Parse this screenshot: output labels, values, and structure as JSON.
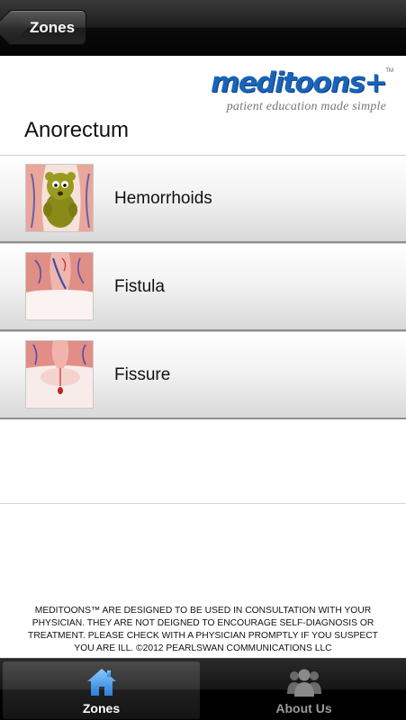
{
  "navbar": {
    "back_label": "Zones"
  },
  "logo": {
    "wordmark": "meditoons",
    "plus": "+",
    "trademark": "TM",
    "tagline": "patient education made simple"
  },
  "section": {
    "title": "Anorectum"
  },
  "items": [
    {
      "label": "Hemorrhoids",
      "icon": "hemorrhoid-character-icon"
    },
    {
      "label": "Fistula",
      "icon": "fistula-illustration-icon"
    },
    {
      "label": "Fissure",
      "icon": "fissure-illustration-icon"
    }
  ],
  "disclaimer": "MEDITOONS™ ARE DESIGNED TO BE USED IN CONSULTATION WITH YOUR PHYSICIAN. THEY ARE NOT DEIGNED TO ENCOURAGE SELF-DIAGNOSIS OR TREATMENT. PLEASE CHECK WITH A PHYSICIAN PROMPTLY IF YOU SUSPECT YOU ARE ILL. ©2012 PEARLSWAN COMMUNICATIONS LLC",
  "tabbar": {
    "tabs": [
      {
        "label": "Zones",
        "icon": "house-icon",
        "active": true
      },
      {
        "label": "About Us",
        "icon": "people-icon",
        "active": false
      }
    ]
  },
  "colors": {
    "brand_blue": "#1a64b8",
    "active_tab_icon": "#3f9be8"
  }
}
